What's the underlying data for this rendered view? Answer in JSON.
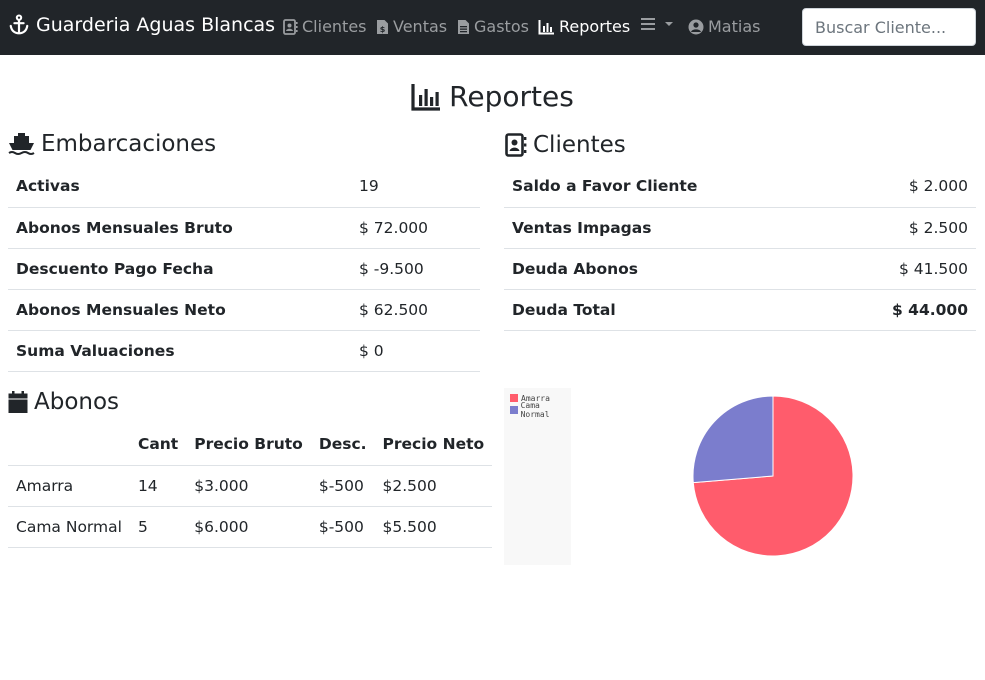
{
  "navbar": {
    "brand": "Guarderia Aguas Blancas",
    "items": [
      {
        "label": "Clientes"
      },
      {
        "label": "Ventas"
      },
      {
        "label": "Gastos"
      },
      {
        "label": "Reportes"
      },
      {
        "label": "Matias"
      }
    ],
    "search_placeholder": "Buscar Cliente..."
  },
  "page": {
    "title": "Reportes"
  },
  "embarcaciones": {
    "title": "Embarcaciones",
    "rows": [
      {
        "label": "Activas",
        "value": "19"
      },
      {
        "label": "Abonos Mensuales Bruto",
        "value": "$ 72.000"
      },
      {
        "label": "Descuento Pago Fecha",
        "value": "$ -9.500"
      },
      {
        "label": "Abonos Mensuales Neto",
        "value": "$ 62.500"
      },
      {
        "label": "Suma Valuaciones",
        "value": "$ 0"
      }
    ]
  },
  "clientes": {
    "title": "Clientes",
    "rows": [
      {
        "label": "Saldo a Favor Cliente",
        "value": "$ 2.000"
      },
      {
        "label": "Ventas Impagas",
        "value": "$ 2.500"
      },
      {
        "label": "Deuda Abonos",
        "value": "$ 41.500"
      },
      {
        "label": "Deuda Total",
        "value": "$ 44.000"
      }
    ]
  },
  "abonos": {
    "title": "Abonos",
    "headers": [
      "",
      "Cant",
      "Precio Bruto",
      "Desc.",
      "Precio Neto"
    ],
    "rows": [
      [
        "Amarra",
        "14",
        "$3.000",
        "$-500",
        "$2.500"
      ],
      [
        "Cama Normal",
        "5",
        "$6.000",
        "$-500",
        "$5.500"
      ]
    ]
  },
  "chart_data": {
    "type": "pie",
    "categories": [
      "Amarra",
      "Cama Normal"
    ],
    "values": [
      14,
      5
    ],
    "colors": [
      "#ff5c6c",
      "#7b7dcd"
    ],
    "legend_position": "top-left"
  }
}
